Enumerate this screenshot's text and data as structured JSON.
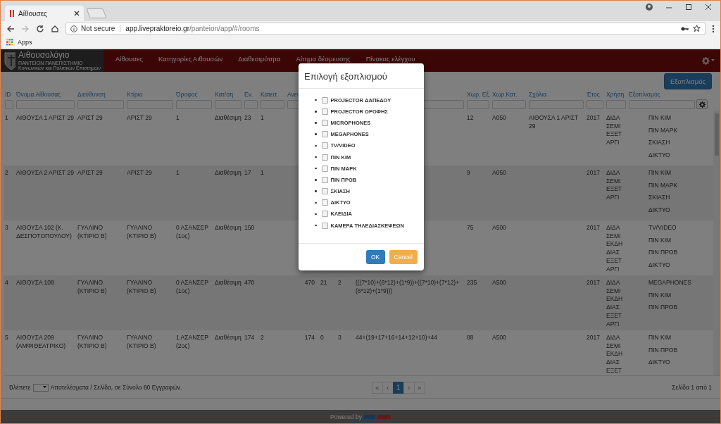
{
  "browser": {
    "tab_title": "Αίθουσες",
    "security": "Not secure",
    "url_host": "app.livepraktoreio.gr",
    "url_path": "/panteion/app/#/rooms",
    "bookmark": "Apps"
  },
  "brand": {
    "title": "Αιθουσολόγιο",
    "line_1": "ΠΑΝΤΕΙΟΝ ΠΑΝΕΠΙΣΤΗΜΙΟ",
    "line_2": "Κοινωνικών και Πολιτικών Επιστημών"
  },
  "nav": [
    "Αίθουσες",
    "Κατηγορίες Αιθουσών",
    "Διαθεσιμότητα",
    "Αίτημα δέσμευσης",
    "Πίνακας ελέγχου"
  ],
  "toolbar_button": "Εξοπλισμός",
  "table": {
    "columns": [
      "ID",
      "Όνομα Αίθουσας",
      "Διεύθυνση",
      "Κτίριο",
      "Όροφος",
      "Κατ/ση",
      "Εν.",
      "Κατεσ.",
      "Ανεν",
      null,
      null,
      null,
      "Χωρ. Εξ.",
      "Χωρ.Κατ.",
      "Σχόλια",
      "Έτος",
      "Χρήση",
      "Εξοπλισμός"
    ],
    "rows": [
      {
        "cells": [
          "1",
          "ΑΙΘΟΥΣΑ 1 ΑΡΙΣΤ 29",
          "ΑΡΙΣΤ 29",
          "ΑΡΙΣΤ 29",
          "1",
          "Διαθέσιμη",
          "23",
          "1",
          null,
          null,
          null,
          null,
          "12",
          "A050",
          "ΑΙΘΟΥΣΑ 1 ΑΡΙΣΤ 29",
          "2017",
          [
            "ΔΙΔΑ",
            "ΣΕΜΙ",
            "ΕΞΕΤ",
            "ΑΡΓΙ"
          ],
          [
            "ΠΙΝ ΚΙΜ",
            "ΠΙΝ ΜΑΡΚ",
            "ΣΚΙΑΣΗ",
            "ΔΙΚΤΥΟ"
          ]
        ]
      },
      {
        "cells": [
          "2",
          "ΑΙΘΟΥΣΑ 2 ΑΡΙΣΤ 29",
          "ΑΡΙΣΤ 29",
          "ΑΡΙΣΤ 29",
          "1",
          "Διαθέσιμη",
          "17",
          "1",
          null,
          null,
          null,
          null,
          "9",
          "A050",
          null,
          "2017",
          [
            "ΔΙΔΑ",
            "ΣΕΜΙ",
            "ΕΞΕΤ",
            "ΑΡΓΙ"
          ],
          [
            "ΠΙΝ ΚΙΜ",
            "ΠΙΝ ΜΑΡΚ",
            "ΣΚΙΑΣΗ",
            "ΔΙΚΤΥΟ"
          ]
        ]
      },
      {
        "cells": [
          "3",
          "ΑΙΘΟΥΣΑ 102 (Κ. ΔΕΣΠΟΤΟΠΟΥΛΟΥ)",
          "ΓΥΑΛΙΝΟ (ΚΤΙΡΙΟ Β)",
          "ΓΥΑΛΙΝΟ (ΚΤΙΡΙΟ Β)",
          "0 ΑΣΑΝΣΕΡ (1ος)",
          "Διαθέσιμη",
          "150",
          null,
          null,
          null,
          null,
          null,
          "75",
          "A500",
          null,
          "2017",
          [
            "ΔΙΔΑ",
            "ΣΕΜΙ",
            "ΕΚΔΗ",
            "ΔΙΑΣ",
            "ΕΞΕΤ",
            "ΑΡΓΙ"
          ],
          [
            "TV/VIDEO",
            "ΠΙΝ ΚΙΜ",
            "ΠΙΝ ΠΡΟΒ",
            "ΔΙΚΤΥΟ"
          ]
        ]
      },
      {
        "cells": [
          "4",
          "ΑΙΘΟΥΣΑ 108",
          "ΓΥΑΛΙΝΟ (ΚΤΙΡΙΟ Β)",
          "ΓΥΑΛΙΝΟ (ΚΤΙΡΙΟ Β)",
          "0 ΑΣΑΝΣΕΡ (1ος)",
          "Διαθέσιμη",
          "470",
          null,
          "470",
          "21",
          "2",
          "(((7*10)+(6*12)+(1*9))+((7*10)+(7*12)+(6*12)+(1*9)))",
          "235",
          "A500",
          null,
          "2017",
          [
            "ΔΙΔΑ",
            "ΣΕΜΙ",
            "ΕΚΔΗ",
            "ΔΙΑΣ",
            "ΕΞΕΤ",
            "ΑΡΓΙ"
          ],
          [
            "MEGAPHONES",
            "ΠΙΝ ΚΙΜ",
            "ΠΙΝ ΠΡΟΒ"
          ]
        ]
      },
      {
        "cells": [
          "5",
          "ΑΙΘΟΥΣΑ 209 (ΑΜΦΙΘΕΑΤΡΙΚΟ)",
          "ΓΥΑΛΙΝΟ (ΚΤΙΡΙΟ Β)",
          "ΓΥΑΛΙΝΟ (ΚΤΙΡΙΟ Β)",
          "1 ΑΣΑΝΣΕΡ (2ος)",
          "Διαθέσιμη",
          "174",
          "2",
          "174",
          "0",
          "3",
          "44+(19+17+16+14+12+10)+44",
          "88",
          "A500",
          null,
          "2017",
          [
            "ΔΙΔΑ",
            "ΣΕΜΙ",
            "ΕΚΔΗ",
            "ΔΙΑΣ",
            "ΕΞΕΤ"
          ],
          [
            "ΠΙΝ ΚΙΜ",
            "ΠΙΝ ΠΡΟΒ",
            "ΔΙΚΤΥΟ"
          ]
        ]
      }
    ]
  },
  "pager": {
    "label": "Βλέπετε",
    "summary": "Αποτελέσματα / Σελίδα, σε Σύνολο 80 Εγγραφών.",
    "pages": [
      {
        "label": "«",
        "selected": false,
        "disabled": true
      },
      {
        "label": "‹",
        "selected": false,
        "disabled": true
      },
      {
        "label": "1",
        "selected": true,
        "disabled": false
      },
      {
        "label": "›",
        "selected": false,
        "disabled": true
      },
      {
        "label": "»",
        "selected": false,
        "disabled": true
      }
    ],
    "page_info": "Σελίδα 1 από 1"
  },
  "footer": "Powered by",
  "modal": {
    "title": "Επιλογή εξοπλισμού",
    "items": [
      {
        "label": "PROJECTOR ΔΑΠΕΔΟΥ",
        "checked": false
      },
      {
        "label": "PROJECTOR ΟΡΟΦΗΣ",
        "checked": false
      },
      {
        "label": "MICROPHONES",
        "checked": false
      },
      {
        "label": "MEGAPHONES",
        "checked": false
      },
      {
        "label": "TV/VIDEO",
        "checked": false
      },
      {
        "label": "ΠΙΝ ΚΙΜ",
        "checked": false
      },
      {
        "label": "ΠΙΝ ΜΑΡΚ",
        "checked": false
      },
      {
        "label": "ΠΙΝ ΠΡΟΒ",
        "checked": false
      },
      {
        "label": "ΣΚΙΑΣΗ",
        "checked": false
      },
      {
        "label": "ΔΙΚΤΥΟ",
        "checked": false
      },
      {
        "label": "ΚΛΕΙΔΙΑ",
        "checked": false
      },
      {
        "label": "ΚΑΜΕΡΑ ΤΗΛΕΔΙΑΣΚΕΨΕΩΝ",
        "checked": false
      }
    ],
    "ok": "OK",
    "cancel": "Cancel"
  }
}
